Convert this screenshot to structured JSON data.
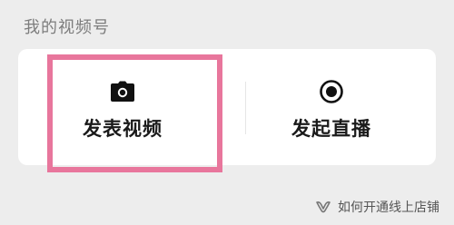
{
  "section": {
    "title": "我的视频号"
  },
  "actions": [
    {
      "label": "发表视频",
      "icon": "camera-icon",
      "highlighted": true
    },
    {
      "label": "发起直播",
      "icon": "record-icon",
      "highlighted": false
    }
  ],
  "watermark": {
    "text": "如何开通线上店铺",
    "icon": "wechat-channels-icon"
  },
  "colors": {
    "highlight": "#e8769c",
    "background": "#ededed",
    "card": "#ffffff"
  }
}
